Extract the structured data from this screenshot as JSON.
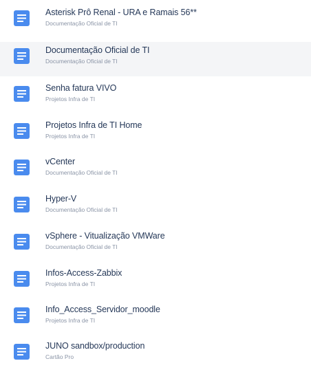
{
  "colors": {
    "icon": "#4a8bee",
    "title": "#253858",
    "space": "#8a94a6",
    "hover_bg": "#f4f5f7"
  },
  "icons": {
    "page": "document-page-icon"
  },
  "items": [
    {
      "title": "Asterisk Prô Renal - URA e Ramais 56**",
      "space": "Documentação Oficial de TI"
    },
    {
      "title": "Documentação Oficial de TI",
      "space": "Documentação Oficial de TI"
    },
    {
      "title": "Senha fatura VIVO",
      "space": "Projetos Infra de TI"
    },
    {
      "title": "Projetos Infra de TI Home",
      "space": "Projetos Infra de TI"
    },
    {
      "title": "vCenter",
      "space": "Documentação Oficial de TI"
    },
    {
      "title": "Hyper-V",
      "space": "Documentação Oficial de TI"
    },
    {
      "title": "vSphere - Vitualização VMWare",
      "space": "Documentação Oficial de TI"
    },
    {
      "title": "Infos-Access-Zabbix",
      "space": "Projetos Infra de TI"
    },
    {
      "title": "Info_Access_Servidor_moodle",
      "space": "Projetos Infra de TI"
    },
    {
      "title": "JUNO sandbox/production",
      "space": "Cartão Pro"
    }
  ]
}
